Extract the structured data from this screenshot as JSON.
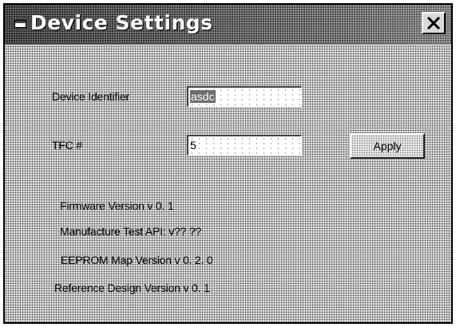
{
  "window": {
    "title": "Device Settings"
  },
  "form": {
    "device_identifier_label": "Device Identifier",
    "device_identifier_value": "asdc",
    "tfc_label": "TFC #",
    "tfc_value": "5",
    "apply_label": "Apply"
  },
  "info": {
    "firmware_version": "Firmware Version v 0. 1",
    "manufacture_test_api": "Manufacture Test API: v?? ??",
    "eeprom_map_version": "EEPROM Map Version v 0. 2. 0",
    "reference_design_version": "Reference Design Version v 0. 1"
  },
  "icons": {
    "app": "window-icon",
    "close": "close-icon"
  }
}
